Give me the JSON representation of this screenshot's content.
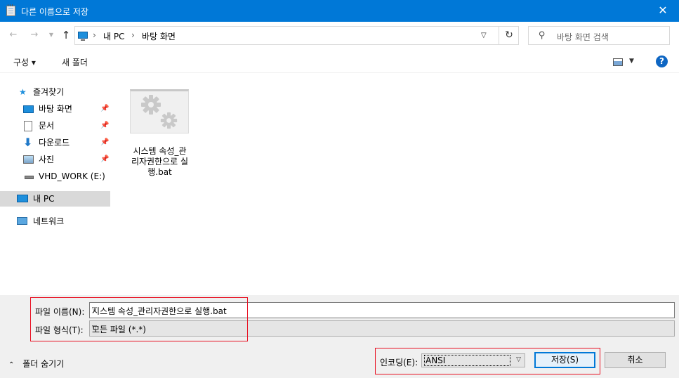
{
  "window": {
    "title": "다른 이름으로 저장",
    "close_glyph": "✕"
  },
  "nav": {
    "back_glyph": "←",
    "forward_glyph": "→",
    "recent_glyph": "⌄",
    "up_glyph": "↑",
    "breadcrumb": [
      "내 PC",
      "바탕 화면"
    ],
    "breadcrumb_sep": "›",
    "search_placeholder": "바탕 화면 검색"
  },
  "commands": {
    "organize": "구성 ▾",
    "new_folder": "새 폴더",
    "help": "?"
  },
  "sidebar": {
    "quick_access": "즐겨찾기",
    "quick_items": [
      {
        "label": "바탕 화면",
        "icon": "desktop-icon"
      },
      {
        "label": "문서",
        "icon": "document-icon"
      },
      {
        "label": "다운로드",
        "icon": "download-icon"
      },
      {
        "label": "사진",
        "icon": "pictures-icon"
      }
    ],
    "drive": "VHD_WORK (E:)",
    "this_pc": "내 PC",
    "network": "네트워크"
  },
  "files": [
    {
      "name": "시스템 속성_관리자권한으로 실행.bat",
      "name_lines": [
        "시스템 속성_관",
        "리자권한으로 실",
        "행.bat"
      ],
      "icon": "batch-file-gears-icon"
    }
  ],
  "form": {
    "filename_label": "파일 이름(N):",
    "filename_value": "시스템 속성_관리자권한으로 실행.bat",
    "filetype_label": "파일 형식(T):",
    "filetype_value": "모든 파일 (*.*)",
    "encoding_label": "인코딩(E):",
    "encoding_value": "ANSI",
    "save_button": "저장(S)",
    "cancel_button": "취소",
    "hide_folders": "폴더 숨기기"
  },
  "colors": {
    "accent": "#0078d7",
    "highlight_box": "#e81123",
    "selected_bg": "#d9d9d9"
  }
}
